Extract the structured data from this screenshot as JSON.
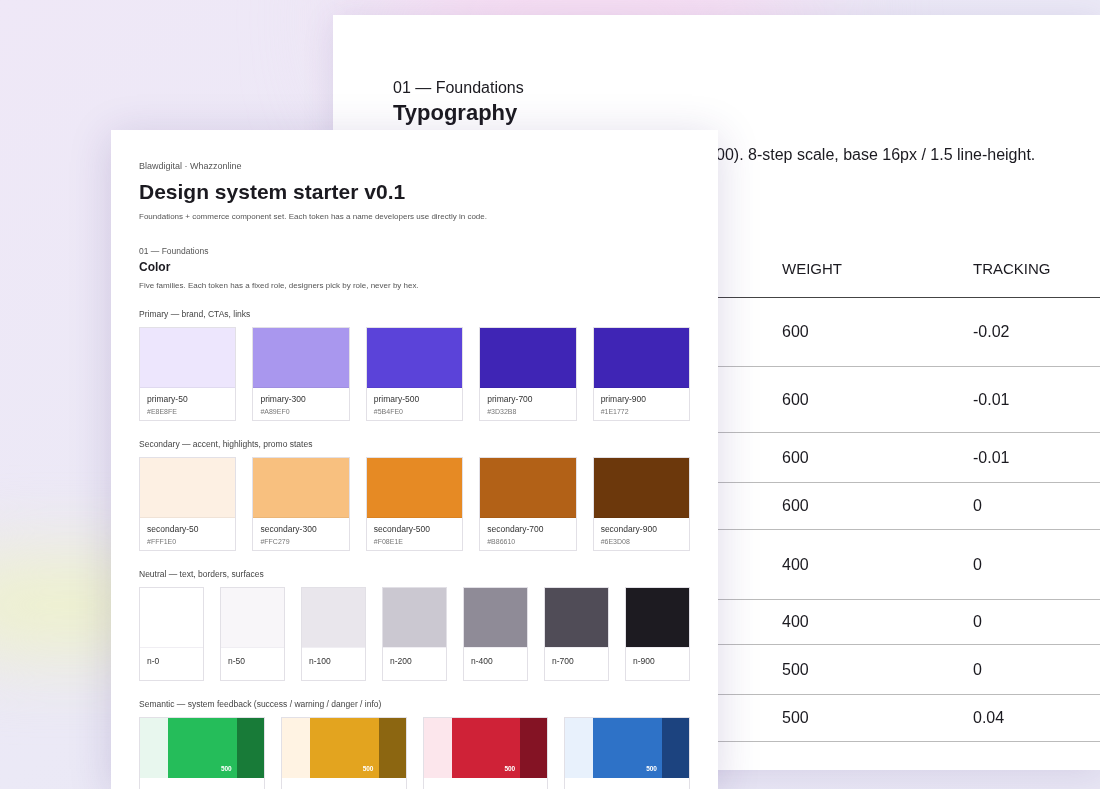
{
  "back_page": {
    "section_label": "01 — Foundations",
    "title": "Typography",
    "description": "00). 8-step scale, base 16px / 1.5 line-height.",
    "table": {
      "columns": [
        "WEIGHT",
        "TRACKING"
      ],
      "rows": [
        {
          "weight": "600",
          "tracking": "-0.02"
        },
        {
          "weight": "600",
          "tracking": "-0.01"
        },
        {
          "weight": "600",
          "tracking": "-0.01"
        },
        {
          "weight": "600",
          "tracking": "0"
        },
        {
          "weight": "400",
          "tracking": "0"
        },
        {
          "weight": "400",
          "tracking": "0"
        },
        {
          "weight": "500",
          "tracking": "0"
        },
        {
          "weight": "500",
          "tracking": "0.04"
        }
      ]
    }
  },
  "front_page": {
    "breadcrumb": "Blawdigital · Whazzonline",
    "title": "Design system starter v0.1",
    "description": "Foundations + commerce component set. Each token has a name developers use directly in code.",
    "section": {
      "label": "01 — Foundations",
      "title": "Color",
      "description": "Five families. Each token has a fixed role, designers pick by role, never by hex.",
      "groups": [
        {
          "kind": "tokens",
          "label": "Primary — brand, CTAs, links",
          "swatches": [
            {
              "name": "primary-50",
              "hex": "#E8E8FE",
              "color": "#ede6fd"
            },
            {
              "name": "primary-300",
              "hex": "#A89EF0",
              "color": "#a997ee"
            },
            {
              "name": "primary-500",
              "hex": "#5B4FE0",
              "color": "#5b43d9"
            },
            {
              "name": "primary-700",
              "hex": "#3D32B8",
              "color": "#3f25b5"
            },
            {
              "name": "primary-900",
              "hex": "#1E1772",
              "color": "#3f25b5"
            }
          ]
        },
        {
          "kind": "tokens",
          "label": "Secondary — accent, highlights, promo states",
          "swatches": [
            {
              "name": "secondary-50",
              "hex": "#FFF1E0",
              "color": "#fdf0e3"
            },
            {
              "name": "secondary-300",
              "hex": "#FFC279",
              "color": "#f8c07f"
            },
            {
              "name": "secondary-500",
              "hex": "#F08E1E",
              "color": "#e68a24"
            },
            {
              "name": "secondary-700",
              "hex": "#B86610",
              "color": "#b26117"
            },
            {
              "name": "secondary-900",
              "hex": "#6E3D08",
              "color": "#6c380c"
            }
          ]
        },
        {
          "kind": "neutral",
          "label": "Neutral — text, borders, surfaces",
          "swatches": [
            {
              "name": "n-0",
              "color": "#ffffff"
            },
            {
              "name": "n-50",
              "color": "#f8f6f9"
            },
            {
              "name": "n-100",
              "color": "#e9e6ec"
            },
            {
              "name": "n-200",
              "color": "#cbc8d1"
            },
            {
              "name": "n-400",
              "color": "#8f8b97"
            },
            {
              "name": "n-700",
              "color": "#504c57"
            },
            {
              "name": "n-900",
              "color": "#1d1b21"
            }
          ]
        },
        {
          "kind": "semantic",
          "label": "Semantic — system feedback (success / warning / danger / info)",
          "cards": [
            {
              "shades": [
                {
                  "color": "#e8f7ee"
                },
                {
                  "color": "#25bd5a",
                  "label": "500"
                },
                {
                  "color": "#187b38"
                }
              ]
            },
            {
              "shades": [
                {
                  "color": "#fff3e3"
                },
                {
                  "color": "#e3a41f",
                  "label": "500"
                },
                {
                  "color": "#8c6611"
                }
              ]
            },
            {
              "shades": [
                {
                  "color": "#fce6ec"
                },
                {
                  "color": "#cf2237",
                  "label": "500"
                },
                {
                  "color": "#841324"
                }
              ]
            },
            {
              "shades": [
                {
                  "color": "#e8f1fc"
                },
                {
                  "color": "#2e72c7",
                  "label": "500"
                },
                {
                  "color": "#1c437f"
                }
              ]
            }
          ]
        }
      ]
    }
  }
}
